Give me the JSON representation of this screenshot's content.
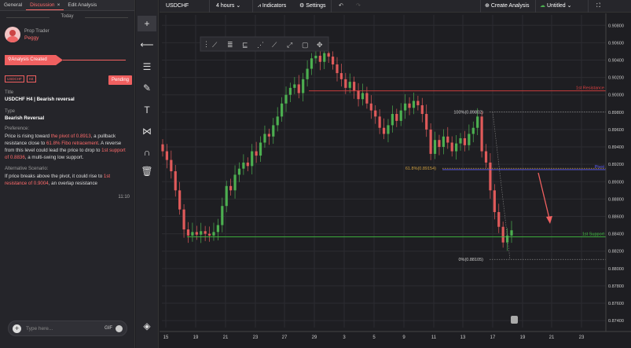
{
  "tabs": [
    "General",
    "Discussion",
    "Edit Analysis"
  ],
  "today": "Today",
  "author": {
    "role": "Prop Trader",
    "name": "Peggy"
  },
  "created": "Analysis Created",
  "badges": [
    "USDCHF",
    "H4"
  ],
  "status": "Pending",
  "title_label": "Title",
  "title_value": "USDCHF H4 | Bearish reversal",
  "type_label": "Type",
  "type_value": "Bearish Reversal",
  "pref_label": "Preference:",
  "pref": {
    "t1": "Price is rising toward ",
    "h1": "the pivot of 0.8913",
    "t2": ", a pullback resistance close to ",
    "h2": "61.8% Fibo retracement",
    "t3": ". A reverse from this level could lead the price to drop to ",
    "h3": "1st support of 0.8836",
    "t4": ", a multi-swing low support."
  },
  "alt_label": "Alternative Scenario:",
  "alt": {
    "t1": "If price breaks above the pivot, it could rise to ",
    "h1": "1st resistance of 0.9004",
    "t2": ", an overlap resistance"
  },
  "time": "11:10",
  "compose": {
    "placeholder": "Type here...",
    "gif": "GIF"
  },
  "topbar": {
    "symbol": "USDCHF",
    "interval": "4 hours",
    "indicators": "Indicators",
    "settings": "Settings",
    "create": "Create Analysis",
    "untitled": "Untitled"
  },
  "colors": {
    "up": "#4caf50",
    "down": "#e05a5a",
    "resistance": "#e04040",
    "pivot": "#6060ff",
    "support": "#40c040"
  },
  "chart_data": {
    "type": "candlestick",
    "yticks": [
      0.908,
      0.906,
      0.904,
      0.902,
      0.9,
      0.898,
      0.896,
      0.894,
      0.892,
      0.89,
      0.888,
      0.886,
      0.884,
      0.882,
      0.88,
      0.878,
      0.876,
      0.874
    ],
    "ylim": [
      0.8732,
      0.9092
    ],
    "xticks": [
      "15",
      "19",
      "21",
      "23",
      "27",
      "29",
      "3",
      "5",
      "9",
      "11",
      "13",
      "17",
      "19",
      "21",
      "23"
    ],
    "levels": [
      {
        "name": "1st Resistance",
        "value": 0.90045,
        "tag": "0.90045"
      },
      {
        "name": "Pivot",
        "value": 0.89139,
        "tag": "0.89139"
      },
      {
        "name": "1st Support",
        "value": 0.88364,
        "tag": "0.88364",
        "tag2": "0.88443"
      }
    ],
    "fib": [
      {
        "label": "100%(0.89802)",
        "value": 0.89802
      },
      {
        "label": "61.8%(0.89154)",
        "value": 0.89154
      },
      {
        "label": "0%(0.88105)",
        "value": 0.88105
      }
    ],
    "closes": [
      0.8935,
      0.8925,
      0.8912,
      0.889,
      0.8868,
      0.8845,
      0.8838,
      0.8842,
      0.8839,
      0.8843,
      0.884,
      0.8838,
      0.8842,
      0.885,
      0.8872,
      0.8895,
      0.889,
      0.8908,
      0.8915,
      0.8922,
      0.8918,
      0.8935,
      0.893,
      0.8945,
      0.8955,
      0.8952,
      0.8965,
      0.8975,
      0.899,
      0.9,
      0.9008,
      0.9012,
      0.9002,
      0.9018,
      0.903,
      0.9042,
      0.9045,
      0.9038,
      0.9048,
      0.9044,
      0.9035,
      0.9025,
      0.9018,
      0.9008,
      0.9015,
      0.9005,
      0.8995,
      0.9002,
      0.899,
      0.8982,
      0.8975,
      0.8962,
      0.8955,
      0.8965,
      0.8978,
      0.897,
      0.8982,
      0.899,
      0.8985,
      0.8993,
      0.8988,
      0.8978,
      0.896,
      0.8932,
      0.8948,
      0.894,
      0.8952,
      0.8945,
      0.8935,
      0.8944,
      0.895,
      0.8942,
      0.8955,
      0.8962,
      0.8975,
      0.8935,
      0.8922,
      0.889,
      0.8865,
      0.8848,
      0.883,
      0.8838,
      0.8844
    ]
  }
}
